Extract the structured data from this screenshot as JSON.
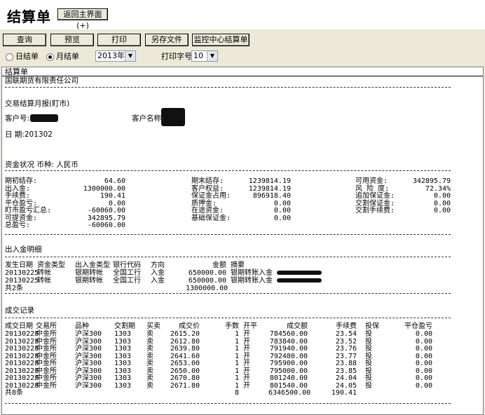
{
  "window": {
    "title": "结算单",
    "back_button": "返回主界面(+)"
  },
  "toolbar": {
    "query": "查询",
    "preview": "预览",
    "print": "打印",
    "save_as": "另存文件",
    "monitor": "监控中心结算单"
  },
  "options": {
    "daily_label": "日结单",
    "monthly_label": "月结单",
    "selected": "monthly",
    "month_value": "2013年02",
    "font_size_label": "打印字号",
    "font_size_value": "10"
  },
  "report": {
    "panel_title": "结算单",
    "company": "国联期货有限责任公司",
    "report_title": "交易结算月报(盯市)",
    "client_no_label": "客户号:",
    "client_name_label": "客户名称",
    "date_label": "日  期:201302",
    "funds_title": "资金状况  币种: 人民币",
    "funds_col1": [
      {
        "label": "期初结存:",
        "value": "64.60"
      },
      {
        "label": "出入金:",
        "value": "1300000.00"
      },
      {
        "label": "手续费:",
        "value": "190.41"
      },
      {
        "label": "平仓盈亏:",
        "value": "0.00"
      },
      {
        "label": "盯市盈亏汇总:",
        "value": "-60060.00"
      },
      {
        "label": "可提资金:",
        "value": "342895.79"
      },
      {
        "label": "总盈亏:",
        "value": "-60060.00"
      }
    ],
    "funds_col2": [
      {
        "label": "期末结存:",
        "value": "1239814.19"
      },
      {
        "label": "客户权益:",
        "value": "1239814.19"
      },
      {
        "label": "保证金占用:",
        "value": "896918.40"
      },
      {
        "label": "质押金:",
        "value": "0.00"
      },
      {
        "label": "在途资金:",
        "value": "0.00"
      },
      {
        "label": "基础保证金:",
        "value": "0.00"
      }
    ],
    "funds_col3": [
      {
        "label": "可用资金:",
        "value": "342895.79"
      },
      {
        "label": "风 险 度:",
        "value": "72.34%"
      },
      {
        "label": "追加保证金:",
        "value": "0.00"
      },
      {
        "label": "交割保证金:",
        "value": "0.00"
      },
      {
        "label": "交割手续费:",
        "value": "0.00"
      }
    ],
    "cash_title": "出入金明细",
    "cash_headers": [
      "发生日期",
      "资金类型",
      "出入金类型",
      "银行代码",
      "方向",
      "金额",
      "摘要"
    ],
    "cash_rows": [
      [
        "20130225",
        "转帐",
        "银期转帐",
        "全国工行",
        "入金",
        "650000.00",
        "银期转账入金"
      ],
      [
        "20130225",
        "转帐",
        "银期转帐",
        "全国工行",
        "入金",
        "650000.00",
        "银期转账入金"
      ]
    ],
    "cash_total_label": "共2条",
    "cash_total_value": "1300000.00",
    "trades_title": "成交记录",
    "trade_headers": [
      "成交日期",
      "交易所",
      "品种",
      "交割期",
      "买卖",
      "成交价",
      "手数",
      "开平",
      "成交额",
      "手续费",
      "投保",
      "平仓盈亏"
    ],
    "trade_rows": [
      [
        "20130228",
        "中金所",
        "沪深300",
        "1303",
        "卖",
        "2615.20",
        "1",
        "开",
        "784560.00",
        "23.54",
        "投",
        "0.00"
      ],
      [
        "20130228",
        "中金所",
        "沪深300",
        "1303",
        "卖",
        "2612.80",
        "1",
        "开",
        "783840.00",
        "23.52",
        "投",
        "0.00"
      ],
      [
        "20130228",
        "中金所",
        "沪深300",
        "1303",
        "卖",
        "2639.80",
        "1",
        "开",
        "791940.00",
        "23.76",
        "投",
        "0.00"
      ],
      [
        "20130228",
        "中金所",
        "沪深300",
        "1303",
        "卖",
        "2641.60",
        "1",
        "开",
        "792480.00",
        "23.77",
        "投",
        "0.00"
      ],
      [
        "20130228",
        "中金所",
        "沪深300",
        "1303",
        "卖",
        "2653.00",
        "1",
        "开",
        "795900.00",
        "23.88",
        "投",
        "0.00"
      ],
      [
        "20130228",
        "中金所",
        "沪深300",
        "1303",
        "卖",
        "2650.00",
        "1",
        "开",
        "795000.00",
        "23.85",
        "投",
        "0.00"
      ],
      [
        "20130228",
        "中金所",
        "沪深300",
        "1303",
        "卖",
        "2670.80",
        "1",
        "开",
        "801240.00",
        "24.04",
        "投",
        "0.00"
      ],
      [
        "20130228",
        "中金所",
        "沪深300",
        "1303",
        "卖",
        "2671.80",
        "1",
        "开",
        "801540.00",
        "24.05",
        "投",
        "0.00"
      ]
    ],
    "trade_total_label": "共8条",
    "trade_total_qty": "8",
    "trade_total_amount": "6346500.00",
    "trade_total_fee": "190.41"
  }
}
